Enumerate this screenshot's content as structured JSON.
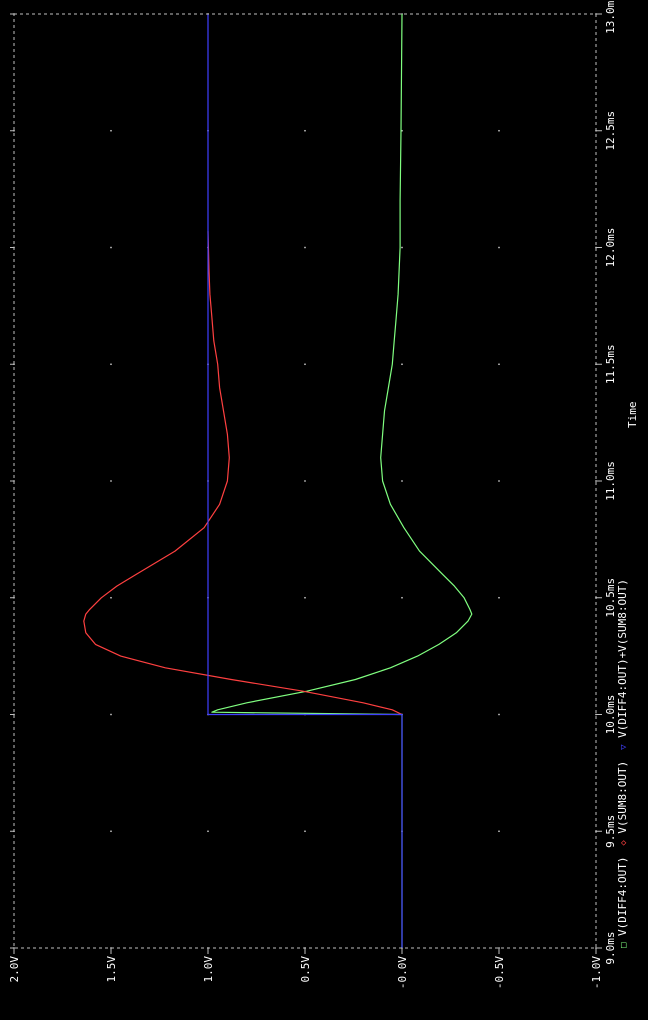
{
  "chart_data": {
    "type": "line",
    "orientation": "rotated-90-ccw",
    "x_label": "Time",
    "x_unit": "ms",
    "xlim": [
      9.0,
      13.0
    ],
    "ylim": [
      -1.0,
      2.0
    ],
    "x_ticks": [
      {
        "value": 9.0,
        "label": "9.0ms"
      },
      {
        "value": 9.5,
        "label": "9.5ms"
      },
      {
        "value": 10.0,
        "label": "10.0ms"
      },
      {
        "value": 10.5,
        "label": "10.5ms"
      },
      {
        "value": 11.0,
        "label": "11.0ms"
      },
      {
        "value": 11.5,
        "label": "11.5ms"
      },
      {
        "value": 12.0,
        "label": "12.0ms"
      },
      {
        "value": 12.5,
        "label": "12.5ms"
      },
      {
        "value": 13.0,
        "label": "13.0ms"
      }
    ],
    "y_ticks": [
      {
        "value": -1.0,
        "label": "-1.0V"
      },
      {
        "value": -0.5,
        "label": "-0.5V"
      },
      {
        "value": 0.0,
        "label": "-0.0V"
      },
      {
        "value": 0.5,
        "label": "0.5V"
      },
      {
        "value": 1.0,
        "label": "1.0V"
      },
      {
        "value": 1.5,
        "label": "1.5V"
      },
      {
        "value": 2.0,
        "label": "2.0V"
      }
    ],
    "grid": "dotted",
    "series": [
      {
        "name": "V(DIFF4:OUT)",
        "marker": "□",
        "color": "#80ff80",
        "points": [
          [
            9.0,
            0.0
          ],
          [
            9.98,
            0.0
          ],
          [
            10.0,
            0.0
          ],
          [
            10.01,
            0.98
          ],
          [
            10.02,
            0.95
          ],
          [
            10.05,
            0.8
          ],
          [
            10.1,
            0.49
          ],
          [
            10.15,
            0.24
          ],
          [
            10.2,
            0.06
          ],
          [
            10.25,
            -0.08
          ],
          [
            10.3,
            -0.19
          ],
          [
            10.35,
            -0.28
          ],
          [
            10.4,
            -0.34
          ],
          [
            10.43,
            -0.36
          ],
          [
            10.45,
            -0.35
          ],
          [
            10.5,
            -0.32
          ],
          [
            10.55,
            -0.27
          ],
          [
            10.6,
            -0.21
          ],
          [
            10.7,
            -0.09
          ],
          [
            10.8,
            -0.01
          ],
          [
            10.9,
            0.06
          ],
          [
            11.0,
            0.1
          ],
          [
            11.1,
            0.11
          ],
          [
            11.2,
            0.1
          ],
          [
            11.3,
            0.09
          ],
          [
            11.4,
            0.07
          ],
          [
            11.5,
            0.05
          ],
          [
            11.6,
            0.04
          ],
          [
            11.7,
            0.03
          ],
          [
            11.8,
            0.02
          ],
          [
            12.0,
            0.01
          ],
          [
            12.2,
            0.01
          ],
          [
            12.5,
            0.005
          ],
          [
            13.0,
            0.0
          ]
        ]
      },
      {
        "name": "V(SUM8:OUT)",
        "marker": "◇",
        "color": "#ff4040",
        "points": [
          [
            10.0,
            0.0
          ],
          [
            10.02,
            0.05
          ],
          [
            10.05,
            0.2
          ],
          [
            10.1,
            0.51
          ],
          [
            10.15,
            0.88
          ],
          [
            10.2,
            1.22
          ],
          [
            10.25,
            1.45
          ],
          [
            10.3,
            1.58
          ],
          [
            10.35,
            1.63
          ],
          [
            10.4,
            1.64
          ],
          [
            10.43,
            1.63
          ],
          [
            10.45,
            1.61
          ],
          [
            10.5,
            1.55
          ],
          [
            10.55,
            1.47
          ],
          [
            10.6,
            1.37
          ],
          [
            10.7,
            1.17
          ],
          [
            10.8,
            1.02
          ],
          [
            10.9,
            0.94
          ],
          [
            11.0,
            0.9
          ],
          [
            11.1,
            0.89
          ],
          [
            11.2,
            0.9
          ],
          [
            11.3,
            0.92
          ],
          [
            11.4,
            0.94
          ],
          [
            11.5,
            0.95
          ],
          [
            11.6,
            0.97
          ],
          [
            11.7,
            0.98
          ],
          [
            11.8,
            0.99
          ],
          [
            11.9,
            0.995
          ],
          [
            12.07,
            1.0
          ]
        ]
      },
      {
        "name": "V(DIFF4:OUT)+V(SUM8:OUT)",
        "marker": "▽",
        "color": "#4040ff",
        "points": [
          [
            9.0,
            0.0
          ],
          [
            10.0,
            0.0
          ],
          [
            10.0,
            1.0
          ],
          [
            13.0,
            1.0
          ]
        ]
      }
    ]
  }
}
